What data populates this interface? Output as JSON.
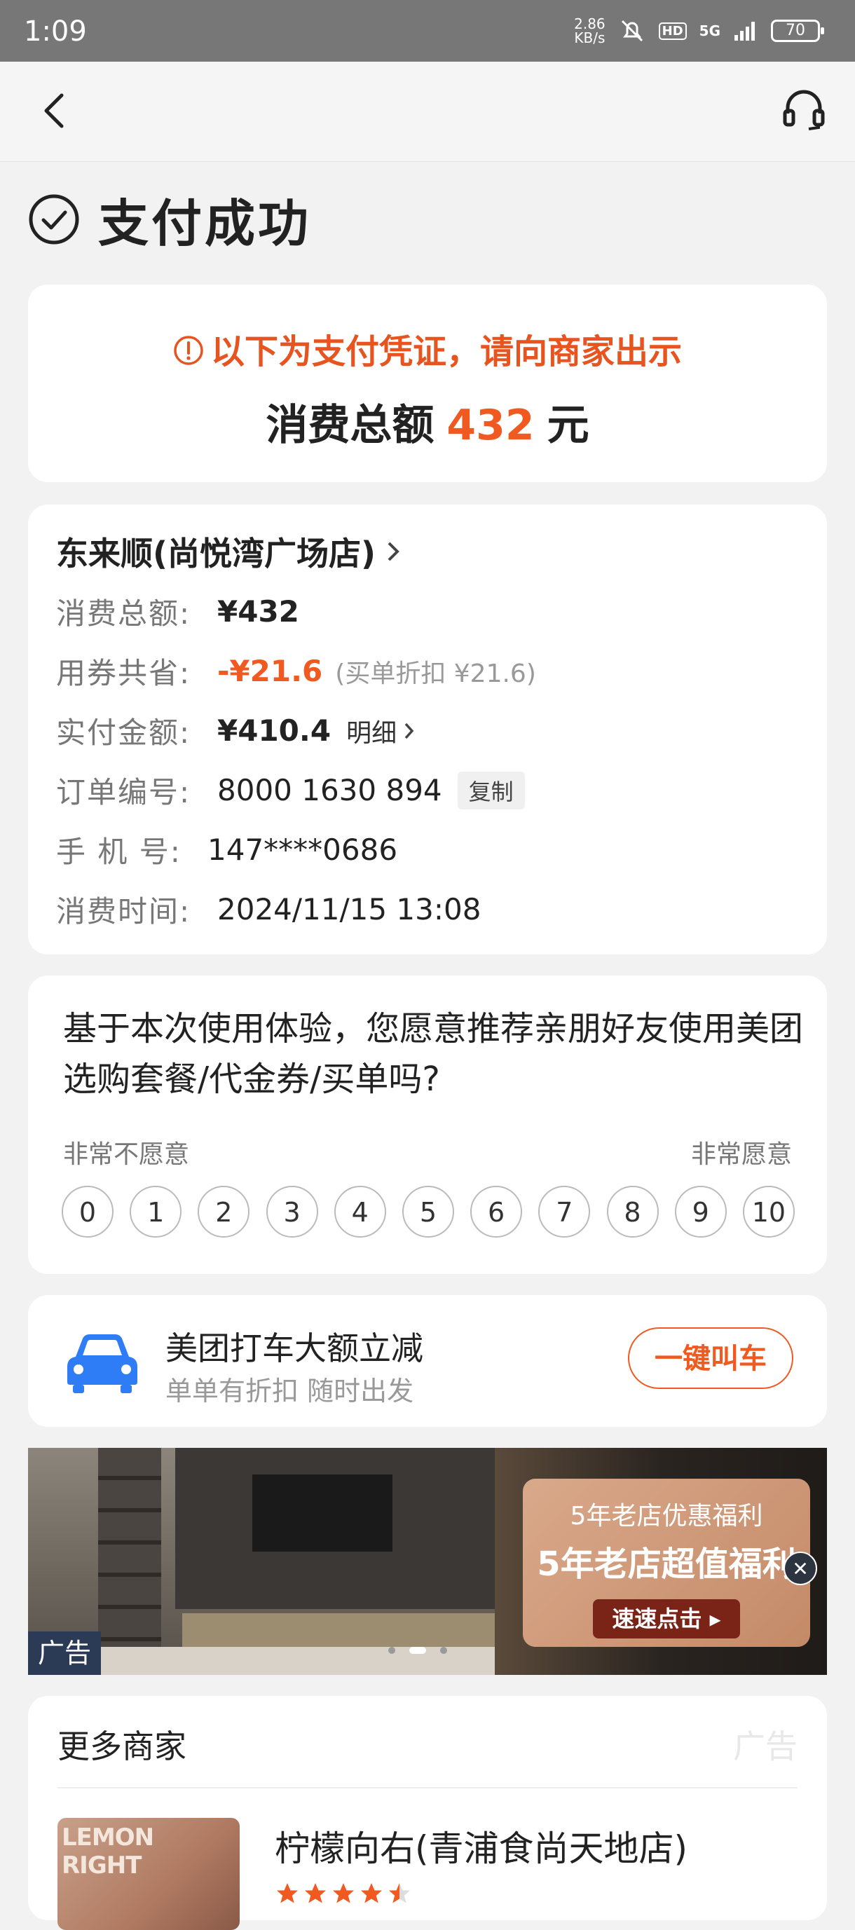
{
  "status_bar": {
    "time": "1:09",
    "net_speed_value": "2.86",
    "net_speed_unit": "KB/s",
    "hd": "HD",
    "network": "5G",
    "battery": "70"
  },
  "header": {
    "title": "支付成功"
  },
  "voucher": {
    "note": "以下为支付凭证，请向商家出示",
    "total_label": "消费总额",
    "total_amount": "432",
    "total_unit": "元"
  },
  "order": {
    "shop_name": "东来顺(尚悦湾广场店)",
    "rows": [
      {
        "label": "消费总额:",
        "value": "¥432"
      },
      {
        "label": "用券共省:",
        "value": "-¥21.6",
        "note": "(买单折扣 ¥21.6)"
      },
      {
        "label": "实付金额:",
        "value": "¥410.4",
        "link": "明细"
      },
      {
        "label": "订单编号:",
        "value": "8000 1630 894",
        "action": "复制"
      },
      {
        "label": "手 机 号:",
        "value": "147****0686"
      },
      {
        "label": "消费时间:",
        "value": "2024/11/15 13:08"
      }
    ]
  },
  "survey": {
    "question": "基于本次使用体验，您愿意推荐亲朋好友使用美团选购套餐/代金券/买单吗?",
    "low_label": "非常不愿意",
    "high_label": "非常愿意",
    "scores": [
      "0",
      "1",
      "2",
      "3",
      "4",
      "5",
      "6",
      "7",
      "8",
      "9",
      "10"
    ]
  },
  "taxi": {
    "title": "美团打车大额立减",
    "subtitle": "单单有折扣 随时出发",
    "button": "一键叫车",
    "accent": "#f05a20"
  },
  "banner": {
    "line1": "5年老店优惠福利",
    "line2": "5年老店超值福利",
    "button": "速速点击 ▸",
    "ad_tag": "广告"
  },
  "more_shops": {
    "title": "更多商家",
    "ad_label": "广告",
    "shop_watermark": "LEMON RIGHT",
    "shop_name": "柠檬向右(青浦食尚天地店)",
    "rating_stars": 4.5
  },
  "colors": {
    "accent": "#f05a20",
    "page_bg": "#f2f2f2",
    "taxi_icon": "#2e7cf6"
  }
}
